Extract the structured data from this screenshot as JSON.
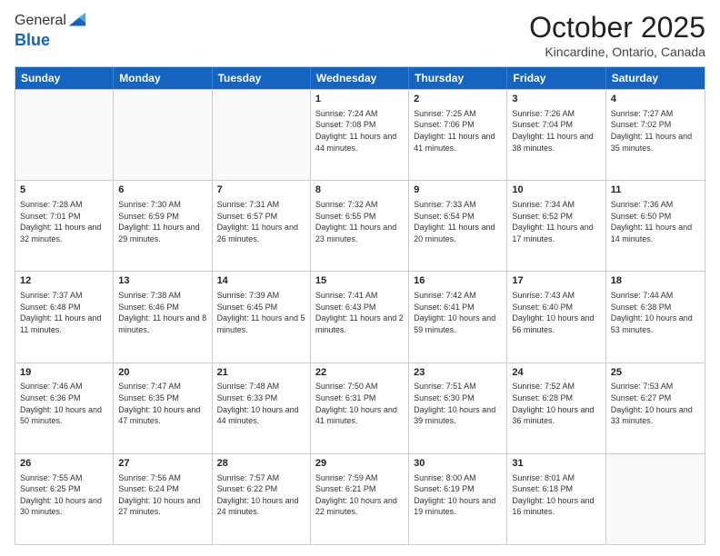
{
  "logo": {
    "general": "General",
    "blue": "Blue"
  },
  "header": {
    "month": "October 2025",
    "location": "Kincardine, Ontario, Canada"
  },
  "days_of_week": [
    "Sunday",
    "Monday",
    "Tuesday",
    "Wednesday",
    "Thursday",
    "Friday",
    "Saturday"
  ],
  "weeks": [
    [
      {
        "day": "",
        "sunrise": "",
        "sunset": "",
        "daylight": "",
        "empty": true
      },
      {
        "day": "",
        "sunrise": "",
        "sunset": "",
        "daylight": "",
        "empty": true
      },
      {
        "day": "",
        "sunrise": "",
        "sunset": "",
        "daylight": "",
        "empty": true
      },
      {
        "day": "1",
        "sunrise": "Sunrise: 7:24 AM",
        "sunset": "Sunset: 7:08 PM",
        "daylight": "Daylight: 11 hours and 44 minutes."
      },
      {
        "day": "2",
        "sunrise": "Sunrise: 7:25 AM",
        "sunset": "Sunset: 7:06 PM",
        "daylight": "Daylight: 11 hours and 41 minutes."
      },
      {
        "day": "3",
        "sunrise": "Sunrise: 7:26 AM",
        "sunset": "Sunset: 7:04 PM",
        "daylight": "Daylight: 11 hours and 38 minutes."
      },
      {
        "day": "4",
        "sunrise": "Sunrise: 7:27 AM",
        "sunset": "Sunset: 7:02 PM",
        "daylight": "Daylight: 11 hours and 35 minutes."
      }
    ],
    [
      {
        "day": "5",
        "sunrise": "Sunrise: 7:28 AM",
        "sunset": "Sunset: 7:01 PM",
        "daylight": "Daylight: 11 hours and 32 minutes."
      },
      {
        "day": "6",
        "sunrise": "Sunrise: 7:30 AM",
        "sunset": "Sunset: 6:59 PM",
        "daylight": "Daylight: 11 hours and 29 minutes."
      },
      {
        "day": "7",
        "sunrise": "Sunrise: 7:31 AM",
        "sunset": "Sunset: 6:57 PM",
        "daylight": "Daylight: 11 hours and 26 minutes."
      },
      {
        "day": "8",
        "sunrise": "Sunrise: 7:32 AM",
        "sunset": "Sunset: 6:55 PM",
        "daylight": "Daylight: 11 hours and 23 minutes."
      },
      {
        "day": "9",
        "sunrise": "Sunrise: 7:33 AM",
        "sunset": "Sunset: 6:54 PM",
        "daylight": "Daylight: 11 hours and 20 minutes."
      },
      {
        "day": "10",
        "sunrise": "Sunrise: 7:34 AM",
        "sunset": "Sunset: 6:52 PM",
        "daylight": "Daylight: 11 hours and 17 minutes."
      },
      {
        "day": "11",
        "sunrise": "Sunrise: 7:36 AM",
        "sunset": "Sunset: 6:50 PM",
        "daylight": "Daylight: 11 hours and 14 minutes."
      }
    ],
    [
      {
        "day": "12",
        "sunrise": "Sunrise: 7:37 AM",
        "sunset": "Sunset: 6:48 PM",
        "daylight": "Daylight: 11 hours and 11 minutes."
      },
      {
        "day": "13",
        "sunrise": "Sunrise: 7:38 AM",
        "sunset": "Sunset: 6:46 PM",
        "daylight": "Daylight: 11 hours and 8 minutes."
      },
      {
        "day": "14",
        "sunrise": "Sunrise: 7:39 AM",
        "sunset": "Sunset: 6:45 PM",
        "daylight": "Daylight: 11 hours and 5 minutes."
      },
      {
        "day": "15",
        "sunrise": "Sunrise: 7:41 AM",
        "sunset": "Sunset: 6:43 PM",
        "daylight": "Daylight: 11 hours and 2 minutes."
      },
      {
        "day": "16",
        "sunrise": "Sunrise: 7:42 AM",
        "sunset": "Sunset: 6:41 PM",
        "daylight": "Daylight: 10 hours and 59 minutes."
      },
      {
        "day": "17",
        "sunrise": "Sunrise: 7:43 AM",
        "sunset": "Sunset: 6:40 PM",
        "daylight": "Daylight: 10 hours and 56 minutes."
      },
      {
        "day": "18",
        "sunrise": "Sunrise: 7:44 AM",
        "sunset": "Sunset: 6:38 PM",
        "daylight": "Daylight: 10 hours and 53 minutes."
      }
    ],
    [
      {
        "day": "19",
        "sunrise": "Sunrise: 7:46 AM",
        "sunset": "Sunset: 6:36 PM",
        "daylight": "Daylight: 10 hours and 50 minutes."
      },
      {
        "day": "20",
        "sunrise": "Sunrise: 7:47 AM",
        "sunset": "Sunset: 6:35 PM",
        "daylight": "Daylight: 10 hours and 47 minutes."
      },
      {
        "day": "21",
        "sunrise": "Sunrise: 7:48 AM",
        "sunset": "Sunset: 6:33 PM",
        "daylight": "Daylight: 10 hours and 44 minutes."
      },
      {
        "day": "22",
        "sunrise": "Sunrise: 7:50 AM",
        "sunset": "Sunset: 6:31 PM",
        "daylight": "Daylight: 10 hours and 41 minutes."
      },
      {
        "day": "23",
        "sunrise": "Sunrise: 7:51 AM",
        "sunset": "Sunset: 6:30 PM",
        "daylight": "Daylight: 10 hours and 39 minutes."
      },
      {
        "day": "24",
        "sunrise": "Sunrise: 7:52 AM",
        "sunset": "Sunset: 6:28 PM",
        "daylight": "Daylight: 10 hours and 36 minutes."
      },
      {
        "day": "25",
        "sunrise": "Sunrise: 7:53 AM",
        "sunset": "Sunset: 6:27 PM",
        "daylight": "Daylight: 10 hours and 33 minutes."
      }
    ],
    [
      {
        "day": "26",
        "sunrise": "Sunrise: 7:55 AM",
        "sunset": "Sunset: 6:25 PM",
        "daylight": "Daylight: 10 hours and 30 minutes."
      },
      {
        "day": "27",
        "sunrise": "Sunrise: 7:56 AM",
        "sunset": "Sunset: 6:24 PM",
        "daylight": "Daylight: 10 hours and 27 minutes."
      },
      {
        "day": "28",
        "sunrise": "Sunrise: 7:57 AM",
        "sunset": "Sunset: 6:22 PM",
        "daylight": "Daylight: 10 hours and 24 minutes."
      },
      {
        "day": "29",
        "sunrise": "Sunrise: 7:59 AM",
        "sunset": "Sunset: 6:21 PM",
        "daylight": "Daylight: 10 hours and 22 minutes."
      },
      {
        "day": "30",
        "sunrise": "Sunrise: 8:00 AM",
        "sunset": "Sunset: 6:19 PM",
        "daylight": "Daylight: 10 hours and 19 minutes."
      },
      {
        "day": "31",
        "sunrise": "Sunrise: 8:01 AM",
        "sunset": "Sunset: 6:18 PM",
        "daylight": "Daylight: 10 hours and 16 minutes."
      },
      {
        "day": "",
        "sunrise": "",
        "sunset": "",
        "daylight": "",
        "empty": true
      }
    ]
  ]
}
